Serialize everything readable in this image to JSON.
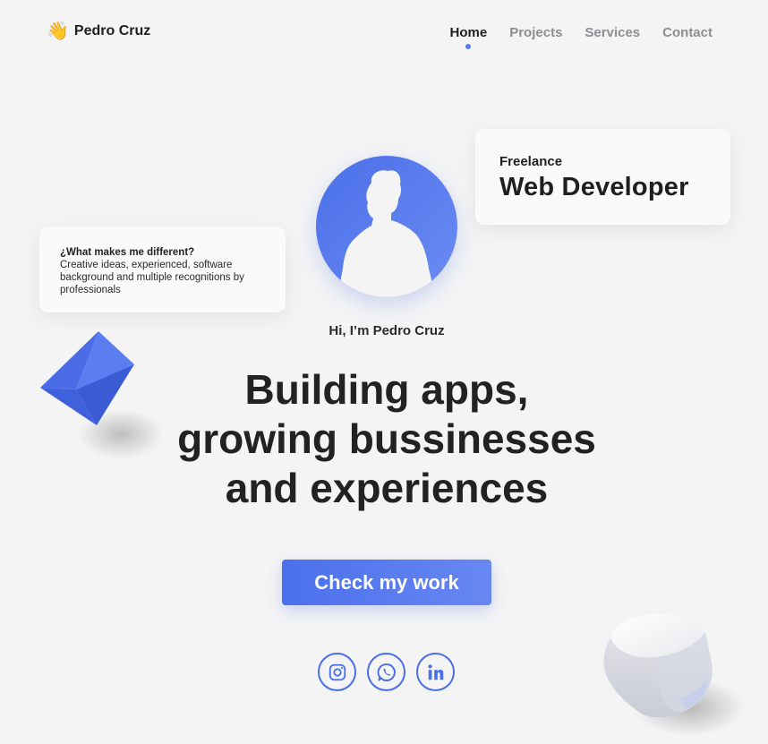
{
  "header": {
    "logo_emoji": "👋",
    "logo_text": "Pedro Cruz",
    "nav": [
      {
        "label": "Home",
        "active": true
      },
      {
        "label": "Projects",
        "active": false
      },
      {
        "label": "Services",
        "active": false
      },
      {
        "label": "Contact",
        "active": false
      }
    ]
  },
  "freelance_card": {
    "small": "Freelance",
    "big": "Web Developer"
  },
  "diff_card": {
    "question": "¿What makes me different?",
    "answer": "Creative ideas, experienced, software background and multiple recognitions by professionals"
  },
  "hero": {
    "greeting": "Hi, I’m Pedro Cruz",
    "headline_line1": "Building apps,",
    "headline_line2": "growing bussinesses",
    "headline_line3": "and experiences",
    "cta_label": "Check my work"
  },
  "socials": [
    {
      "icon": "instagram-icon"
    },
    {
      "icon": "whatsapp-icon"
    },
    {
      "icon": "linkedin-icon"
    }
  ],
  "colors": {
    "accent": "#4b6fe8",
    "background": "#f4f4f5",
    "text": "#1f1f1f",
    "muted_nav": "#8d8d92"
  }
}
